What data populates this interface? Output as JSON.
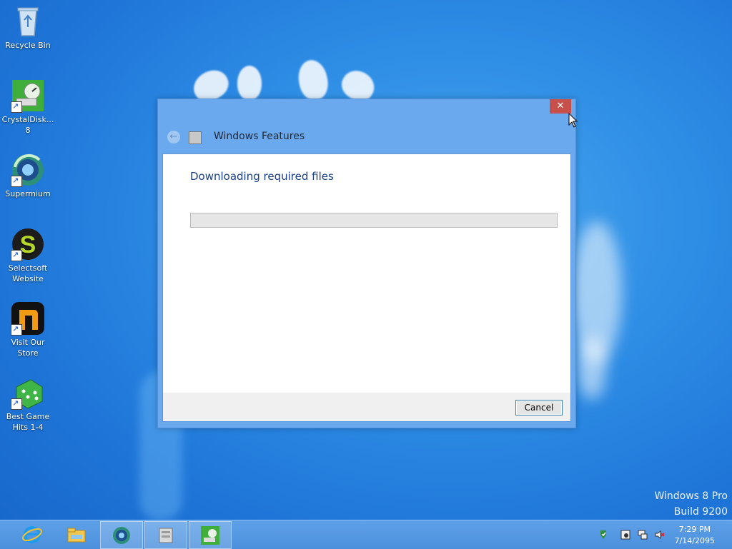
{
  "desktop": {
    "icons": [
      {
        "label": "Recycle Bin"
      },
      {
        "label": "CrystalDisk... 8"
      },
      {
        "label": "Supermium"
      },
      {
        "label": "Selectsoft Website"
      },
      {
        "label": "Visit Our Store"
      },
      {
        "label": "Best Game Hits 1-4"
      }
    ]
  },
  "dialog": {
    "title": "Windows Features",
    "close_glyph": "✕",
    "back_glyph": "←",
    "heading": "Downloading required files",
    "progress_fraction": 0.0,
    "cancel_label": "Cancel"
  },
  "watermark": {
    "line1": "Windows 8 Pro",
    "line2": "Build 9200"
  },
  "taskbar": {
    "pinned": [
      {
        "icon": "internet-explorer-icon"
      },
      {
        "icon": "file-explorer-icon"
      },
      {
        "icon": "supermium-icon"
      },
      {
        "icon": "windows-features-icon"
      },
      {
        "icon": "crystaldisk-icon"
      }
    ],
    "tray_icons": [
      "action-center-icon",
      "media-icon",
      "network-icon",
      "volume-muted-icon"
    ],
    "clock_time": "7:29 PM",
    "clock_date": "7/14/2095"
  },
  "colors": {
    "desktop_blue": "#2f8fe6",
    "dialog_frame": "#6aa9ee",
    "close_red": "#c7504a",
    "heading_blue": "#1b3f86"
  }
}
